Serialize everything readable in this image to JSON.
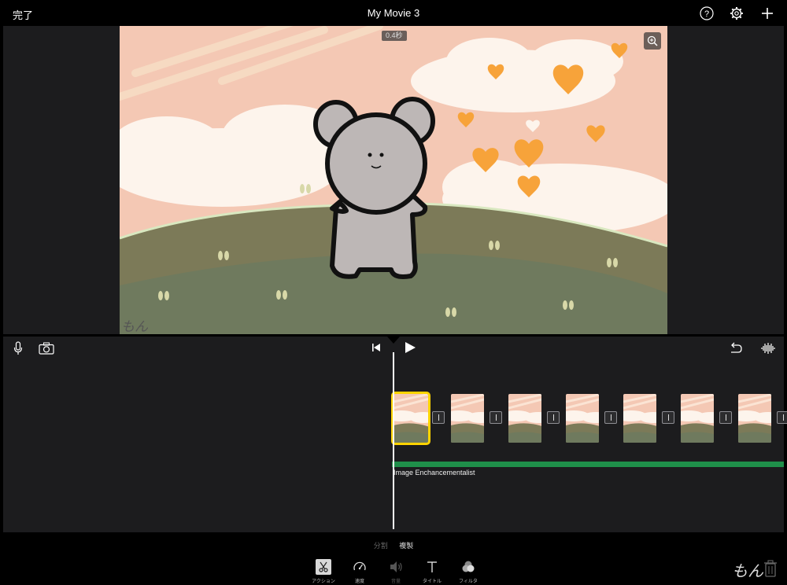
{
  "header": {
    "done_label": "完了",
    "title": "My Movie 3",
    "icons": [
      "help-icon",
      "gear-icon",
      "plus-icon"
    ]
  },
  "viewer": {
    "duration_badge": "0.4秒",
    "signature": "もん",
    "zoom_icon": "magnifier-plus-icon"
  },
  "timeline": {
    "left_controls": [
      "microphone-icon",
      "camera-icon"
    ],
    "center_controls": [
      "skip-to-start-icon",
      "play-icon"
    ],
    "right_controls": [
      "undo-icon",
      "waveform-icon"
    ],
    "clip_count": 7,
    "selected_clip_index": 0,
    "audio_track_label": "Image Enchancementalist",
    "audio_color": "#1f8f4a",
    "selection_color": "#ffd400"
  },
  "toolbar": {
    "split_label": "分割",
    "duplicate_label": "複製",
    "tools": [
      {
        "label": "アクション",
        "icon": "scissors-icon"
      },
      {
        "label": "速度",
        "icon": "speedometer-icon"
      },
      {
        "label": "音量",
        "icon": "speaker-icon"
      },
      {
        "label": "タイトル",
        "icon": "title-t-icon"
      },
      {
        "label": "フィルタ",
        "icon": "filter-circles-icon"
      }
    ],
    "watermark": "もん",
    "trash_icon": "trash-icon"
  }
}
